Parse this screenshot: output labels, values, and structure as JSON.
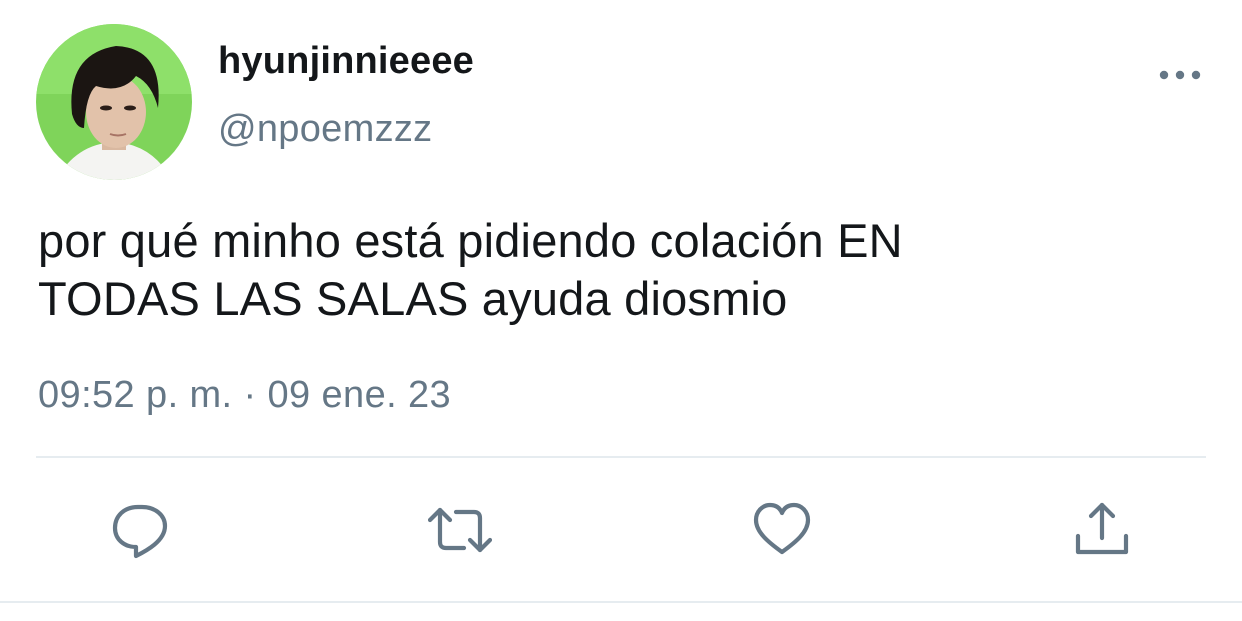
{
  "tweet": {
    "display_name": "hyunjinnieeee",
    "handle": "@npoemzzz",
    "text_line1": "por qué minho está pidiendo colación EN",
    "text_line2": "TODAS LAS SALAS ayuda diosmio",
    "timestamp": "09:52 p. m. · 09 ene. 23"
  },
  "icons": {
    "more": "more-horizontal-icon",
    "reply": "reply-icon",
    "retweet": "retweet-icon",
    "like": "heart-icon",
    "share": "share-icon"
  },
  "colors": {
    "text_primary": "#14171a",
    "text_secondary": "#657786",
    "divider": "#e6ecf0",
    "avatar_bg": "#7fd45a"
  }
}
